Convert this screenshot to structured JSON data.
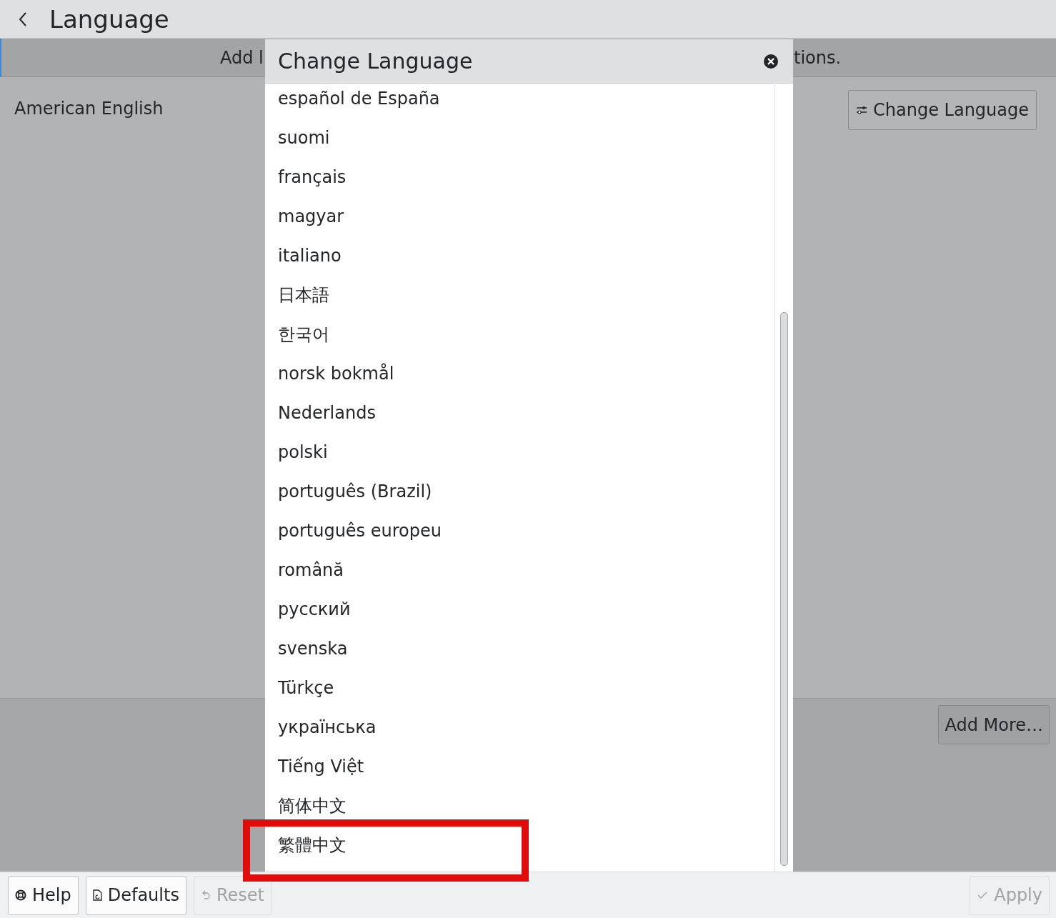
{
  "page": {
    "title": "Language"
  },
  "banner": {
    "text_left": "Add l",
    "text_right": "tions."
  },
  "languages": [
    {
      "name": "American English"
    }
  ],
  "change_language_button": "Change Language",
  "add_more_button": "Add More…",
  "dialog": {
    "title": "Change Language",
    "items": [
      {
        "label": "español de España",
        "highlighted": false
      },
      {
        "label": "suomi",
        "highlighted": false
      },
      {
        "label": "français",
        "highlighted": false
      },
      {
        "label": "magyar",
        "highlighted": false
      },
      {
        "label": "italiano",
        "highlighted": false
      },
      {
        "label": "日本語",
        "highlighted": false
      },
      {
        "label": "한국어",
        "highlighted": false
      },
      {
        "label": "norsk bokmål",
        "highlighted": false
      },
      {
        "label": "Nederlands",
        "highlighted": false
      },
      {
        "label": "polski",
        "highlighted": false
      },
      {
        "label": "português (Brazil)",
        "highlighted": false
      },
      {
        "label": "português europeu",
        "highlighted": false
      },
      {
        "label": "română",
        "highlighted": false
      },
      {
        "label": "русский",
        "highlighted": false
      },
      {
        "label": "svenska",
        "highlighted": false
      },
      {
        "label": "Türkçe",
        "highlighted": false
      },
      {
        "label": "українська",
        "highlighted": false
      },
      {
        "label": "Tiếng Việt",
        "highlighted": false
      },
      {
        "label": "简体中文",
        "highlighted": false
      },
      {
        "label": "繁體中文",
        "highlighted": true
      }
    ]
  },
  "footer_buttons": [
    {
      "label": "Help",
      "kind": "help",
      "disabled": false
    },
    {
      "label": "Defaults",
      "kind": "defaults",
      "disabled": false
    },
    {
      "label": "Reset",
      "kind": "reset",
      "disabled": true
    },
    {
      "label": "Apply",
      "kind": "apply",
      "disabled": true
    }
  ]
}
